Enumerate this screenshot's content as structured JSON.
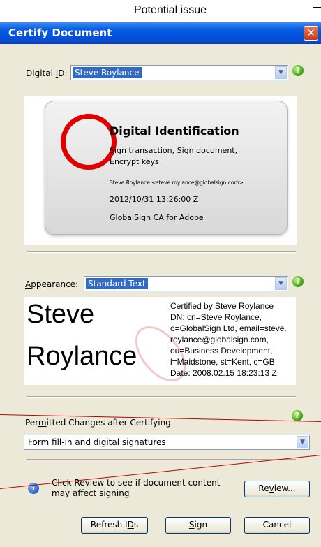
{
  "caption": "Potential issue",
  "dialog": {
    "title": "Certify Document",
    "close_label": "✕"
  },
  "digital_id": {
    "label_pre": "Digital ",
    "label_ul": "I",
    "label_post": "D:",
    "value": "Steve Roylance"
  },
  "card": {
    "title": "Digital Identification",
    "usage_line1": "Sign transaction, Sign document,",
    "usage_line2": "Encrypt keys",
    "email": "Steve Roylance <steve.roylance@globalsign.com>",
    "date": "2012/10/31 13:26:00 Z",
    "issuer": "GlobalSign CA for Adobe"
  },
  "appearance": {
    "label_ul": "A",
    "label_post": "ppearance:",
    "value": "Standard Text",
    "name_line1": "Steve",
    "name_line2": "Roylance",
    "cert_lines": [
      "Certified by Steve Roylance",
      "DN: cn=Steve Roylance,",
      "o=GlobalSign Ltd, email=steve.",
      "roylance@globalsign.com,",
      "ou=Business Development,",
      "l=Maidstone, st=Kent, c=GB",
      "Date: 2008.02.15 18:23:13 Z"
    ]
  },
  "permitted": {
    "label_pre": "Per",
    "label_ul": "m",
    "label_post": "itted Changes after Certifying",
    "value": "Form fill-in and digital signatures"
  },
  "review": {
    "info_line1": "Click Review to see if document content",
    "info_line2": "may affect signing",
    "button_pre": "Re",
    "button_ul": "v",
    "button_post": "iew..."
  },
  "buttons": {
    "refresh_pre": "Refresh I",
    "refresh_ul": "D",
    "refresh_post": "s",
    "sign_ul": "S",
    "sign_post": "ign",
    "cancel": "Cancel"
  },
  "icons": {
    "help": "?",
    "info": "i",
    "dropdown": "▼"
  },
  "colors": {
    "selection": "#316ac5",
    "annotation": "#e00000",
    "titlebar": "#0054e3"
  }
}
